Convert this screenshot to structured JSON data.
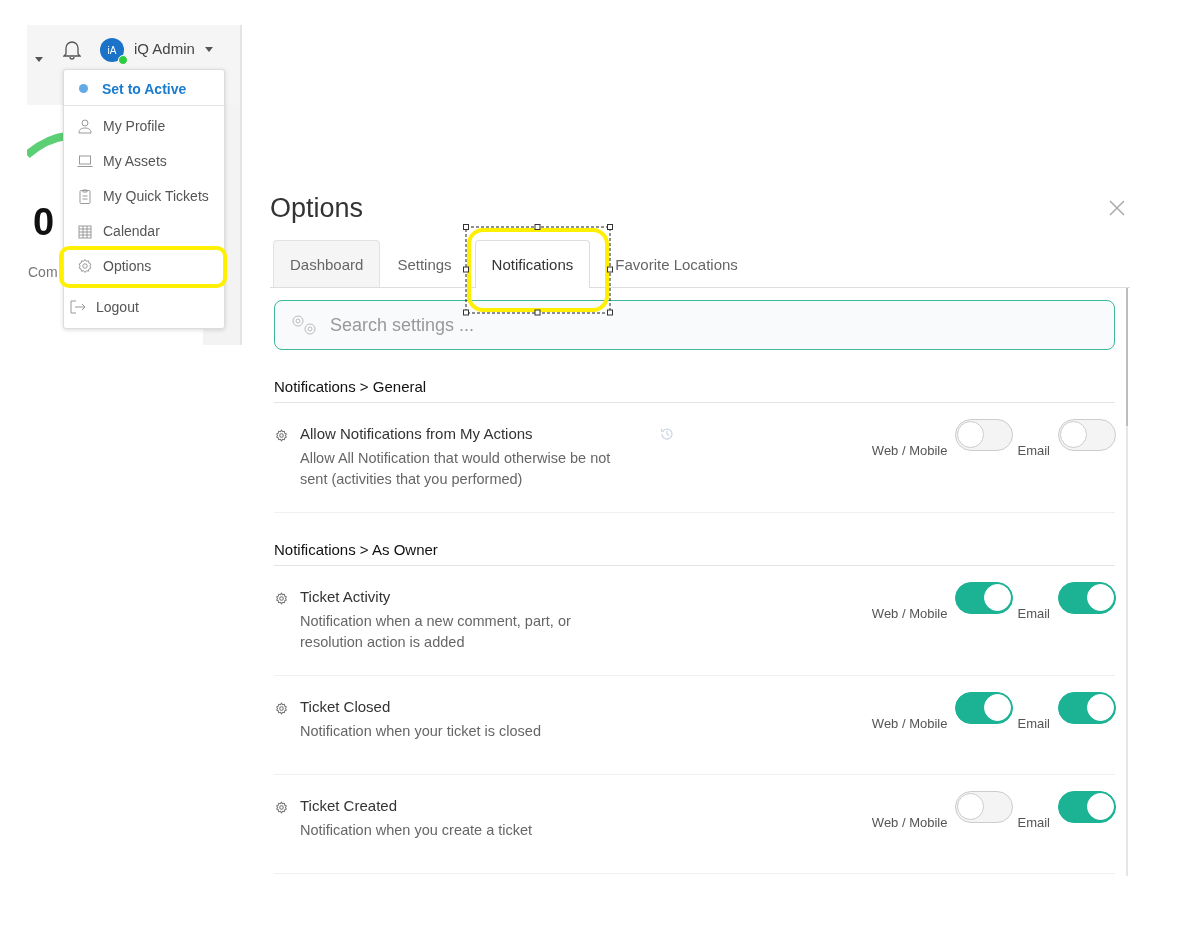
{
  "header": {
    "user_name": "iQ Admin",
    "avatar_initials": "iA",
    "online": true
  },
  "dashboard_fragment": {
    "value": "0",
    "label": "Com"
  },
  "user_menu": {
    "status_action": "Set to Active",
    "items": [
      {
        "label": "My Profile",
        "kind": "person",
        "highlighted": false
      },
      {
        "label": "My Assets",
        "kind": "laptop",
        "highlighted": false
      },
      {
        "label": "My Quick Tickets",
        "kind": "clipboard",
        "highlighted": false
      },
      {
        "label": "Calendar",
        "kind": "calendar",
        "highlighted": false
      },
      {
        "label": "Options",
        "kind": "gear",
        "highlighted": true
      }
    ],
    "logout": "Logout"
  },
  "dialog": {
    "title": "Options",
    "tabs": [
      {
        "label": "Dashboard",
        "selected": false,
        "hovered": true,
        "highlighted": false
      },
      {
        "label": "Settings",
        "selected": false,
        "hovered": false,
        "highlighted": false
      },
      {
        "label": "Notifications",
        "selected": true,
        "hovered": false,
        "highlighted": true
      },
      {
        "label": "Favorite Locations",
        "selected": false,
        "hovered": false,
        "highlighted": false
      }
    ],
    "search": {
      "placeholder": "Search settings ..."
    },
    "sections": [
      {
        "title": "Notifications > General",
        "settings": [
          {
            "name": "Allow Notifications from My Actions",
            "description": "Allow All Notification that would otherwise be not sent (activities that you performed)",
            "history_icon": true,
            "web_mobile": {
              "label": "Web / Mobile",
              "on": false
            },
            "email": {
              "label": "Email",
              "on": false
            }
          }
        ]
      },
      {
        "title": "Notifications > As Owner",
        "settings": [
          {
            "name": "Ticket Activity",
            "description": "Notification when a new comment, part, or resolution action is added",
            "history_icon": false,
            "web_mobile": {
              "label": "Web / Mobile",
              "on": true
            },
            "email": {
              "label": "Email",
              "on": true
            }
          },
          {
            "name": "Ticket Closed",
            "description": "Notification when your ticket is closed",
            "history_icon": false,
            "web_mobile": {
              "label": "Web / Mobile",
              "on": true
            },
            "email": {
              "label": "Email",
              "on": true
            }
          },
          {
            "name": "Ticket Created",
            "description": "Notification when you create a ticket",
            "history_icon": false,
            "web_mobile": {
              "label": "Web / Mobile",
              "on": false
            },
            "email": {
              "label": "Email",
              "on": true
            }
          }
        ]
      }
    ]
  }
}
